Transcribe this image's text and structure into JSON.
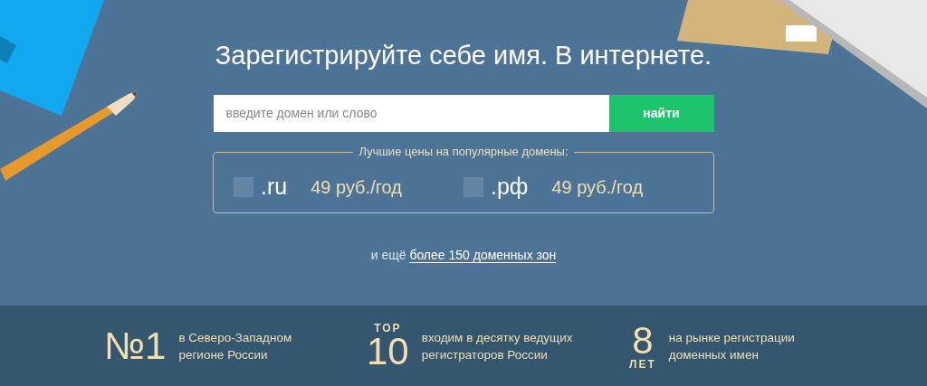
{
  "hero": {
    "title": "Зарегистрируйте себе имя. В интернете.",
    "search": {
      "placeholder": "введите домен или слово",
      "button": "найти"
    },
    "offers": {
      "legend": "Лучшие цены на популярные домены:",
      "items": [
        {
          "zone": ".ru",
          "price": "49 руб./год",
          "checked": false
        },
        {
          "zone": ".рф",
          "price": "49 руб./год",
          "checked": false
        }
      ]
    },
    "more": {
      "prefix": "и ещё",
      "link": "более 150 доменных зон"
    }
  },
  "stats": [
    {
      "kind": "number",
      "big": "№1",
      "text_lines": [
        "в Северо-Западном",
        "регионе России"
      ]
    },
    {
      "kind": "top",
      "top": "TOP",
      "big": "10",
      "text_lines": [
        "входим в десятку ведущих",
        "регистраторов России"
      ]
    },
    {
      "kind": "years",
      "big": "8",
      "bottom": "ЛЕТ",
      "text_lines": [
        "на рынке регистрации",
        "доменных имен"
      ]
    }
  ]
}
